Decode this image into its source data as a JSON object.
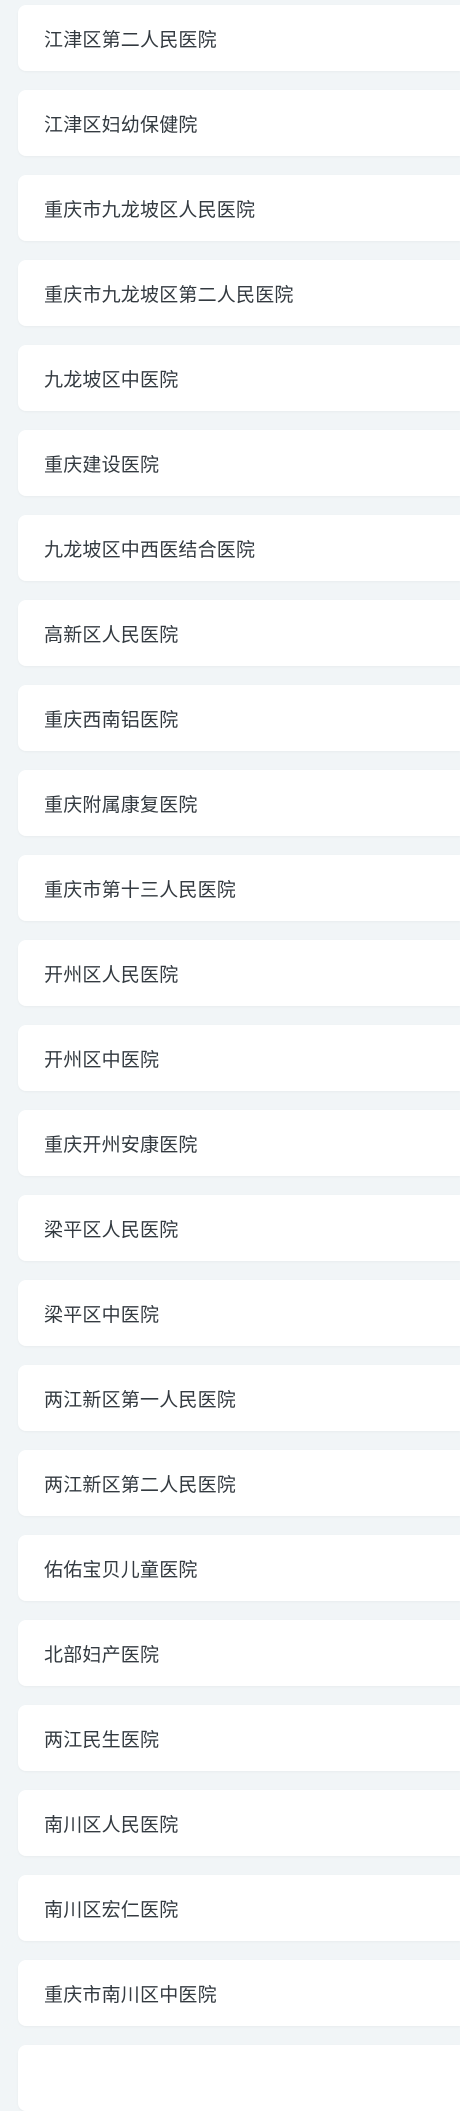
{
  "hospitals": [
    "江津区第二人民医院",
    "江津区妇幼保健院",
    "重庆市九龙坡区人民医院",
    "重庆市九龙坡区第二人民医院",
    "九龙坡区中医院",
    "重庆建设医院",
    "九龙坡区中西医结合医院",
    "高新区人民医院",
    "重庆西南铝医院",
    "重庆附属康复医院",
    "重庆市第十三人民医院",
    "开州区人民医院",
    "开州区中医院",
    "重庆开州安康医院",
    "梁平区人民医院",
    "梁平区中医院",
    "两江新区第一人民医院",
    "两江新区第二人民医院",
    "佑佑宝贝儿童医院",
    "北部妇产医院",
    "两江民生医院",
    "南川区人民医院",
    "南川区宏仁医院",
    "重庆市南川区中医院"
  ],
  "colors": {
    "background": "#f1f5f7",
    "card": "#ffffff",
    "text": "#333a40"
  }
}
